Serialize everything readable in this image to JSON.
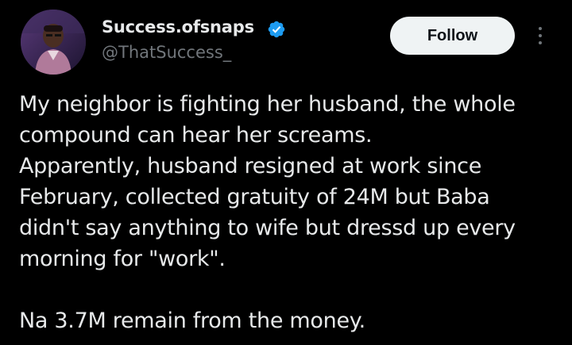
{
  "author": {
    "display_name": "Success.ofsnaps",
    "handle": "@ThatSuccess_",
    "verified_icon": "verified-badge-icon",
    "avatar_icon": "profile-avatar"
  },
  "actions": {
    "follow_label": "Follow",
    "more_icon": "more-options-icon"
  },
  "tweet": {
    "lines": [
      "My neighbor is fighting her husband, the whole",
      "compound can hear her screams.",
      "Apparently, husband resigned at work since",
      "February, collected gratuity of 24M but Baba",
      "didn't say anything to wife but dressd up every",
      "morning for \"work\".",
      "",
      "Na 3.7M remain from the money."
    ]
  },
  "colors": {
    "background": "#000000",
    "text_primary": "#e7e9ea",
    "text_secondary": "#71767b",
    "verified_blue": "#1d9bf0",
    "button_bg": "#eff3f4",
    "button_text": "#0f1419"
  }
}
